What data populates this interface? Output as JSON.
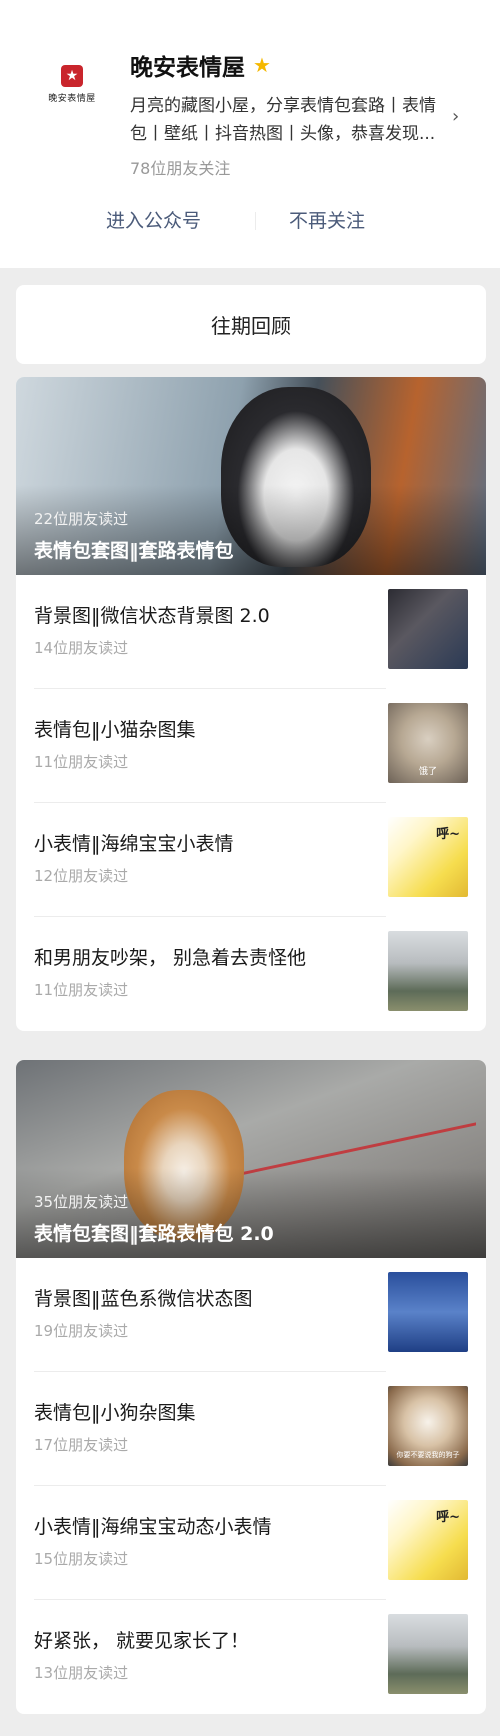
{
  "account": {
    "name": "晚安表情屋",
    "logo_text": "晚安表情屋",
    "description": "月亮的藏图小屋，分享表情包套路丨表情包丨壁纸丨抖音热图丨头像，恭喜发现...",
    "followers": "78位朋友关注",
    "enter_label": "进入公众号",
    "unfollow_label": "不再关注"
  },
  "history_label": "往期回顾",
  "groups": [
    {
      "cover": {
        "count": "22位朋友读过",
        "title": "表情包套图‖套路表情包"
      },
      "articles": [
        {
          "title": "背景图‖微信状态背景图 2.0",
          "count": "14位朋友读过"
        },
        {
          "title": "表情包‖小猫杂图集",
          "count": "11位朋友读过",
          "thumb_caption": "饿了"
        },
        {
          "title": "小表情‖海绵宝宝小表情",
          "count": "12位朋友读过",
          "thumb_caption": "呼~"
        },
        {
          "title": "和男朋友吵架， 别急着去责怪他",
          "count": "11位朋友读过"
        }
      ]
    },
    {
      "cover": {
        "count": "35位朋友读过",
        "title": "表情包套图‖套路表情包 2.0"
      },
      "articles": [
        {
          "title": "背景图‖蓝色系微信状态图",
          "count": "19位朋友读过"
        },
        {
          "title": "表情包‖小狗杂图集",
          "count": "17位朋友读过",
          "thumb_caption": "你要不要说我的狗子"
        },
        {
          "title": "小表情‖海绵宝宝动态小表情",
          "count": "15位朋友读过",
          "thumb_caption": "呼~"
        },
        {
          "title": "好紧张， 就要见家长了！",
          "count": "13位朋友读过"
        }
      ]
    }
  ],
  "colors": {
    "link": "#4b5b7a",
    "star": "#f5b800",
    "background": "#ededed"
  }
}
